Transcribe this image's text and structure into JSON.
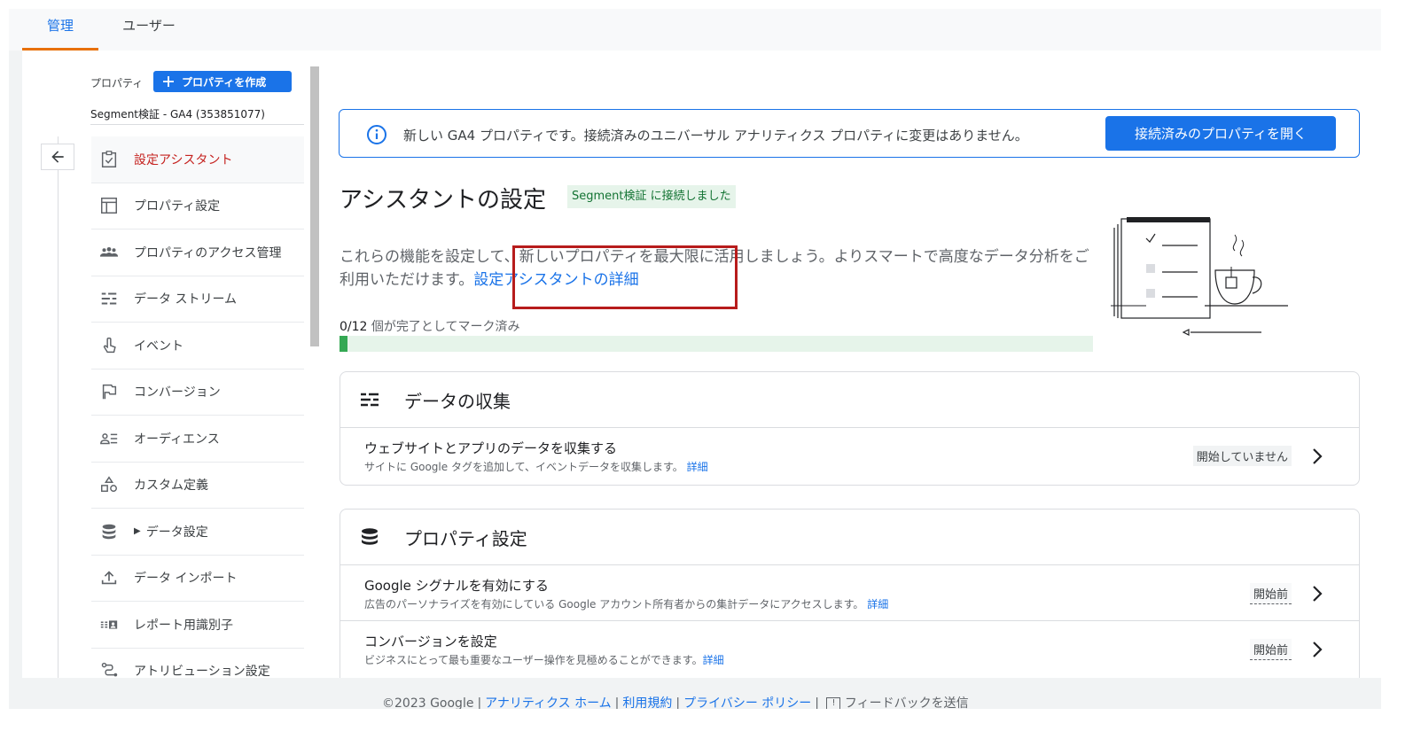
{
  "tabs": [
    {
      "label": "管理",
      "active": true
    },
    {
      "label": "ユーザー",
      "active": false
    }
  ],
  "sidebar": {
    "property_label": "プロパティ",
    "create_button": "プロパティを作成",
    "property_name": "Segment検証 - GA4 (353851077)",
    "items": [
      {
        "label": "設定アシスタント",
        "icon": "checklist-icon",
        "selected": true
      },
      {
        "label": "プロパティ設定",
        "icon": "layout-icon"
      },
      {
        "label": "プロパティのアクセス管理",
        "icon": "people-icon"
      },
      {
        "label": "データ ストリーム",
        "icon": "streams-icon"
      },
      {
        "label": "イベント",
        "icon": "touch-icon"
      },
      {
        "label": "コンバージョン",
        "icon": "flag-icon"
      },
      {
        "label": "オーディエンス",
        "icon": "audience-icon"
      },
      {
        "label": "カスタム定義",
        "icon": "shapes-icon"
      },
      {
        "label": "データ設定",
        "icon": "database-icon"
      },
      {
        "label": "データ インポート",
        "icon": "upload-icon"
      },
      {
        "label": "レポート用識別子",
        "icon": "identity-icon"
      },
      {
        "label": "アトリビューション設定",
        "icon": "attribution-icon"
      }
    ]
  },
  "banner": {
    "text": "新しい GA4 プロパティです。接続済みのユニバーサル アナリティクス プロパティに変更はありません。",
    "button": "接続済みのプロパティを開く"
  },
  "main": {
    "title": "アシスタントの設定",
    "badge": "Segment検証 に接続しました",
    "description": "これらの機能を設定して、新しいプロパティを最大限に活用しましょう。よりスマートで高度なデータ分析をご利用いただけます。",
    "description_link": "設定アシスタントの詳細",
    "progress_count": "0/12",
    "progress_text": " 個が完了としてマーク済み",
    "progress_fraction": 0.01
  },
  "cards": [
    {
      "title": "データの収集",
      "icon": "streams-icon",
      "rows": [
        {
          "title": "ウェブサイトとアプリのデータを収集する",
          "sub": "サイトに Google タグを追加して、イベントデータを収集します。",
          "link": "詳細",
          "status": "開始していません"
        }
      ]
    },
    {
      "title": "プロパティ設定",
      "icon": "database-icon",
      "rows": [
        {
          "title": "Google シグナルを有効にする",
          "sub": "広告のパーソナライズを有効にしている Google アカウント所有者からの集計データにアクセスします。",
          "link": "詳細",
          "status": "開始前"
        },
        {
          "title": "コンバージョンを設定",
          "sub": "ビジネスにとって最も重要なユーザー操作を見極めることができます。",
          "link": "詳細",
          "status": "開始前"
        }
      ]
    }
  ],
  "footer": {
    "copyright": "©2023 Google",
    "links": [
      "アナリティクス ホーム",
      "利用規約",
      "プライバシー ポリシー"
    ],
    "feedback": "フィードバックを送信"
  },
  "colors": {
    "accent": "#1a73e8",
    "selected_text": "#c5221f",
    "progress": "#34a853",
    "tab_indicator": "#e8710a"
  }
}
